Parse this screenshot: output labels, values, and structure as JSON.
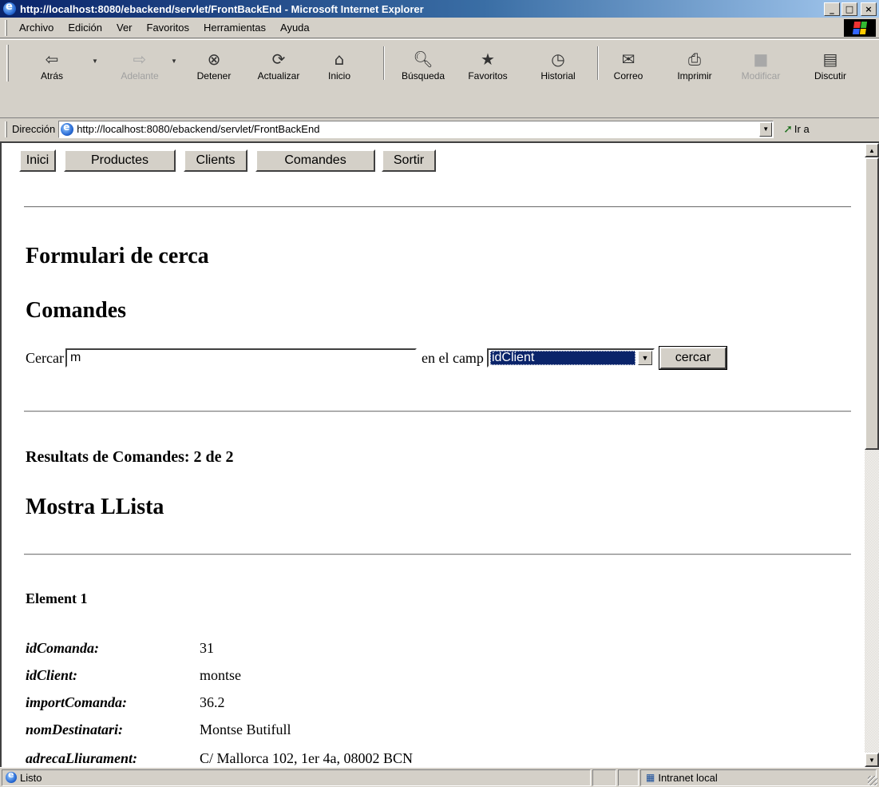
{
  "window": {
    "title": "http://localhost:8080/ebackend/servlet/FrontBackEnd - Microsoft Internet Explorer",
    "controls": {
      "minimize": "_",
      "maximize": "□",
      "close": "×"
    }
  },
  "menu": [
    "Archivo",
    "Edición",
    "Ver",
    "Favoritos",
    "Herramientas",
    "Ayuda"
  ],
  "toolbar": {
    "back": "Atrás",
    "forward": "Adelante",
    "stop": "Detener",
    "refresh": "Actualizar",
    "home": "Inicio",
    "search": "Búsqueda",
    "favorites": "Favoritos",
    "history": "Historial",
    "mail": "Correo",
    "print": "Imprimir",
    "edit": "Modificar",
    "discuss": "Discutir"
  },
  "address": {
    "label": "Dirección",
    "url": "http://localhost:8080/ebackend/servlet/FrontBackEnd",
    "go": "Ir a"
  },
  "page": {
    "nav": [
      "Inici",
      "Productes",
      "Clients",
      "Comandes",
      "Sortir"
    ],
    "search_form_title": "Formulari de cerca",
    "section_title": "Comandes",
    "search_label": "Cercar",
    "search_value": "m",
    "field_label": "en el camp",
    "field_selected": "idClient",
    "search_button": "cercar",
    "results_summary": "Resultats de Comandes: 2 de 2",
    "list_title": "Mostra LLista",
    "element_title": "Element 1",
    "fields": [
      {
        "key": "idComanda:",
        "value": "31"
      },
      {
        "key": "idClient:",
        "value": "montse"
      },
      {
        "key": "importComanda:",
        "value": "36.2"
      },
      {
        "key": "nomDestinatari:",
        "value": "Montse Butifull"
      },
      {
        "key": "adrecaLliurament:",
        "value": "C/ Mallorca 102, 1er 4a, 08002 BCN"
      }
    ]
  },
  "status": {
    "text": "Listo",
    "zone": "Intranet local"
  }
}
